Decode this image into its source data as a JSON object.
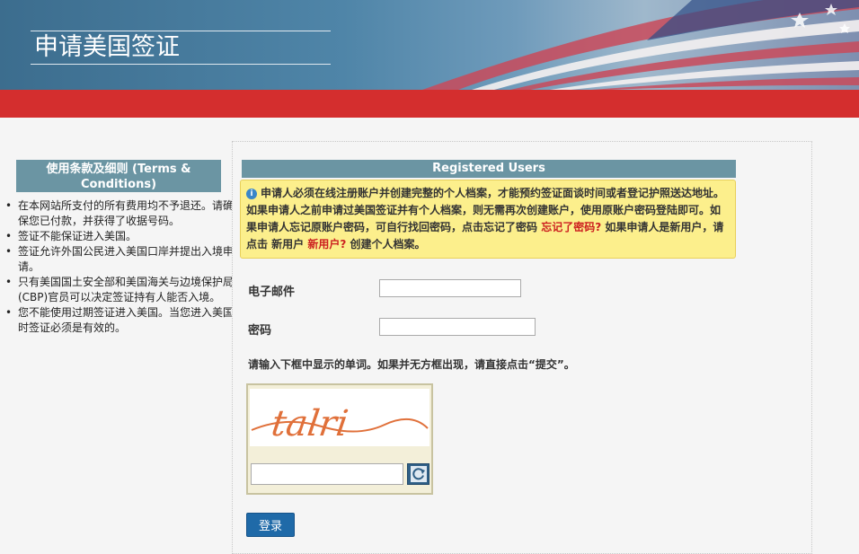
{
  "header": {
    "title": "申请美国签证"
  },
  "sidebar": {
    "heading": "使用条款及细则 (Terms & Conditions)",
    "items": [
      {
        "text": "在本网站所支付的所有费用均不予退还。请确保您已付款，并获得了收据号码。"
      },
      {
        "text": "签证不能保证进入美国。"
      },
      {
        "text": "签证允许外国公民进入美国口岸并提出入境申请。"
      },
      {
        "text": "只有美国国土安全部和美国海关与边境保护局(CBP)官员可以决定签证持有人能否入境。"
      },
      {
        "text": "您不能使用过期签证进入美国。当您进入美国时签证必须是有效的。"
      }
    ]
  },
  "login": {
    "heading": "Registered Users",
    "notice": {
      "text_1": "申请人必须在线注册账户并创建完整的个人档案，才能预约签证面谈时间或者登记护照送达地址。如果申请人之前申请过美国签证并有个人档案，则无需再次创建账户，使用原账户密码登陆即可。如果申请人忘记原账户密码，可自行找回密码，点击忘记了密码",
      "forgot_link": "忘记了密码?",
      "text_2": "如果申请人是新用户，请点击 新用户",
      "new_user_link": "新用户?",
      "text_3": "创建个人档案。"
    },
    "email_label": "电子邮件",
    "email_value": "",
    "password_label": "密码",
    "password_value": "",
    "captcha_instruction": "请输入下框中显示的单词。如果并无方框出现，请直接点击“提交”。",
    "captcha_word": "talri",
    "captcha_value": "",
    "submit_label": "登录"
  },
  "colors": {
    "red_bar": "#d42e2e",
    "section_header": "#6b95a3",
    "notice_bg": "#fcef8c",
    "button": "#1f6aa8",
    "link": "#cc2020"
  }
}
